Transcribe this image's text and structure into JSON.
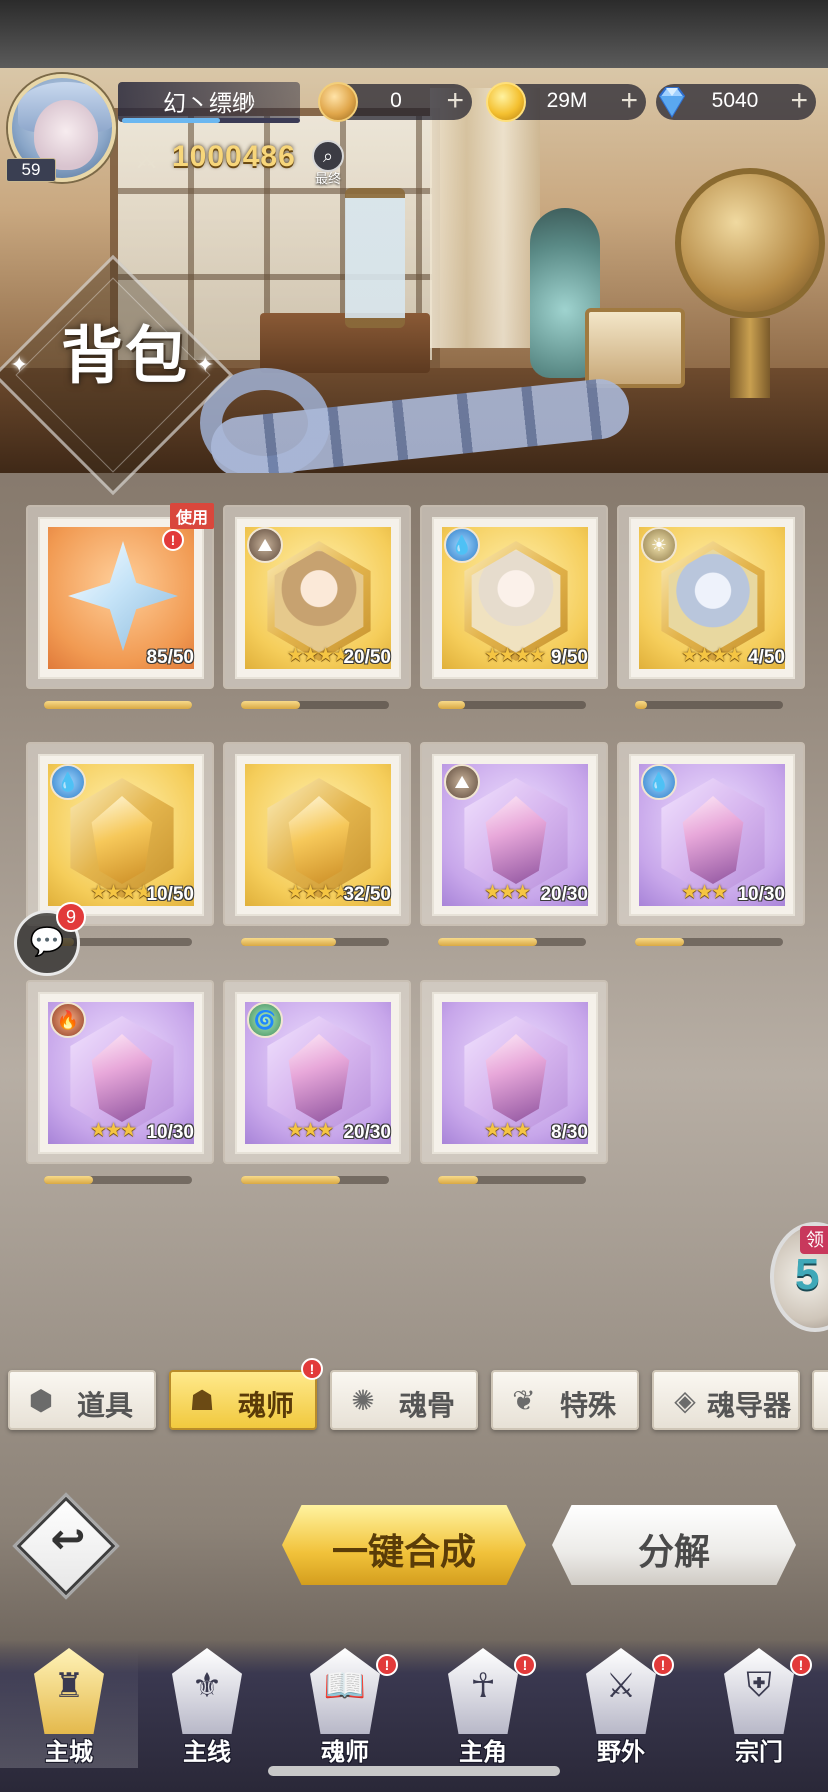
{
  "player": {
    "name": "幻丶缥缈",
    "level": "59",
    "power": "1000486",
    "rank_label": "最终",
    "exp_fraction": 0.55
  },
  "currencies": [
    {
      "name": "coin",
      "value": "0",
      "icon": "coin-icon"
    },
    {
      "name": "gold",
      "value": "29M",
      "icon": "gold-coin-icon"
    },
    {
      "name": "diamond",
      "value": "5040",
      "icon": "diamond-icon"
    }
  ],
  "page_title": "背包",
  "use_tag": "使用",
  "items": [
    {
      "type": "shard",
      "rarity": "orange",
      "element": "",
      "stars": 0,
      "count": "85/50",
      "progress": 1.0,
      "use": true
    },
    {
      "type": "portrait",
      "rarity": "gold",
      "element": "earth",
      "stars": 4,
      "count": "20/50",
      "progress": 0.4
    },
    {
      "type": "portrait",
      "rarity": "gold",
      "element": "water",
      "stars": 4,
      "count": "9/50",
      "progress": 0.18
    },
    {
      "type": "portrait",
      "rarity": "gold",
      "element": "light",
      "stars": 4,
      "count": "4/50",
      "progress": 0.08
    },
    {
      "type": "crystal",
      "rarity": "gold",
      "element": "water",
      "stars": 4,
      "count": "10/50",
      "progress": 0.2
    },
    {
      "type": "crystal",
      "rarity": "gold",
      "element": "",
      "stars": 4,
      "count": "32/50",
      "progress": 0.64
    },
    {
      "type": "crystal",
      "rarity": "purple",
      "element": "earth",
      "stars": 3,
      "count": "20/30",
      "progress": 0.67
    },
    {
      "type": "crystal",
      "rarity": "purple",
      "element": "water",
      "stars": 3,
      "count": "10/30",
      "progress": 0.33
    },
    {
      "type": "crystal",
      "rarity": "purple",
      "element": "fire",
      "stars": 3,
      "count": "10/30",
      "progress": 0.33
    },
    {
      "type": "crystal",
      "rarity": "purple",
      "element": "wind",
      "stars": 3,
      "count": "20/30",
      "progress": 0.67
    },
    {
      "type": "crystal",
      "rarity": "purple",
      "element": "",
      "stars": 3,
      "count": "8/30",
      "progress": 0.27
    }
  ],
  "chat": {
    "unread": "9"
  },
  "side_reward": {
    "label": "领",
    "number": "5"
  },
  "tabs": [
    {
      "label": "道具",
      "icon": "item-icon",
      "active": false,
      "alert": false
    },
    {
      "label": "魂师",
      "icon": "soul-master-icon",
      "active": true,
      "alert": true
    },
    {
      "label": "魂骨",
      "icon": "soul-bone-icon",
      "active": false,
      "alert": false
    },
    {
      "label": "特殊",
      "icon": "feather-icon",
      "active": false,
      "alert": false
    },
    {
      "label": "魂导器",
      "icon": "soul-device-icon",
      "active": false,
      "alert": false
    }
  ],
  "actions": {
    "merge_label": "一键合成",
    "decompose_label": "分解"
  },
  "nav": [
    {
      "label": "主城",
      "icon": "castle-icon",
      "active": true,
      "alert": false
    },
    {
      "label": "主线",
      "icon": "mainline-icon",
      "active": false,
      "alert": false
    },
    {
      "label": "魂师",
      "icon": "book-icon",
      "active": false,
      "alert": true
    },
    {
      "label": "主角",
      "icon": "hero-icon",
      "active": false,
      "alert": true
    },
    {
      "label": "野外",
      "icon": "wild-icon",
      "active": false,
      "alert": true
    },
    {
      "label": "宗门",
      "icon": "sect-icon",
      "active": false,
      "alert": true
    }
  ],
  "colors": {
    "accent_gold": "#f1c93e",
    "alert_red": "#e23a3a",
    "progress_gold": "#d9a944"
  }
}
